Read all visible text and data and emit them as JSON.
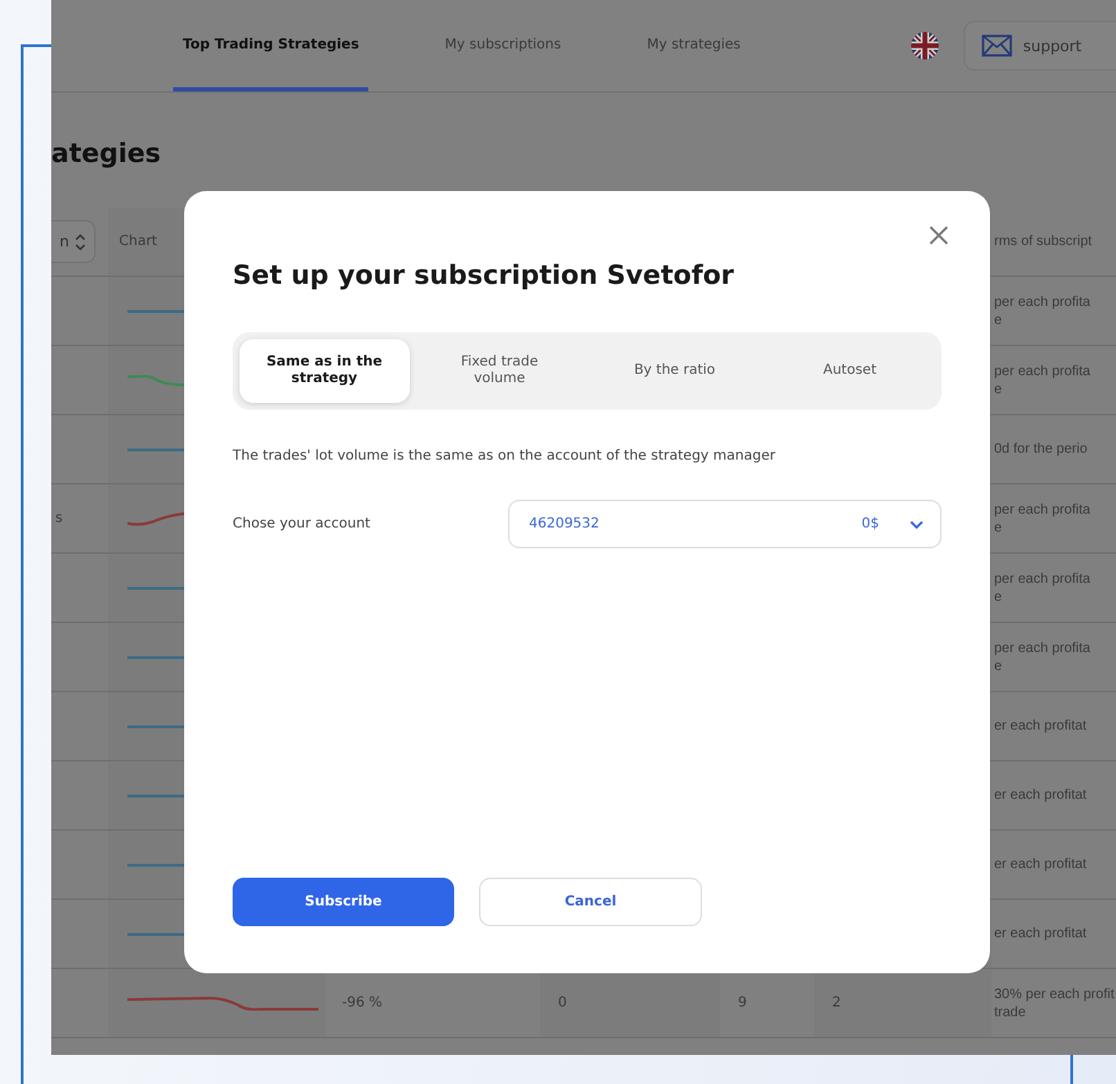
{
  "nav": {
    "tabs": [
      {
        "label": "Top Trading Strategies",
        "selected": true
      },
      {
        "label": "My subscriptions",
        "selected": false
      },
      {
        "label": "My strategies",
        "selected": false
      }
    ],
    "support": "support"
  },
  "page_title": "ategies",
  "table": {
    "sort_label": "n",
    "columns": [
      "Chart",
      "rms of subscript"
    ],
    "rows": [
      {
        "color": "#3e6a86",
        "kind": "flat",
        "terms": [
          "per each profita",
          "e"
        ]
      },
      {
        "color": "#3f8a55",
        "kind": "dip",
        "terms": [
          "per each profita",
          "e"
        ]
      },
      {
        "color": "#3e6a86",
        "kind": "flat",
        "terms": [
          "0d for the perio"
        ]
      },
      {
        "color": "#8a3a3a",
        "kind": "rise",
        "column_1": "s",
        "terms": [
          "per each profita",
          "e"
        ]
      },
      {
        "color": "#3e6a86",
        "kind": "flat",
        "terms": [
          "per each profita",
          "e"
        ]
      },
      {
        "color": "#3e6a86",
        "kind": "flat",
        "terms": [
          "per each profita",
          "e"
        ]
      },
      {
        "color": "#3e6a86",
        "kind": "flat",
        "terms": [
          "er each profitat"
        ]
      },
      {
        "color": "#3e6a86",
        "kind": "flat",
        "terms": [
          "er each profitat"
        ]
      },
      {
        "color": "#3e6a86",
        "kind": "flat",
        "terms": [
          "er each profitat"
        ]
      },
      {
        "color": "#3e6a86",
        "kind": "flat",
        "terms": [
          "er each profitat"
        ]
      },
      {
        "color": "#8a3a3a",
        "kind": "fall",
        "return": "-96 %",
        "column_4": "0",
        "column_5": "9",
        "column_6": "2",
        "terms": [
          "30% per each profit",
          "trade"
        ]
      }
    ]
  },
  "modal": {
    "title": "Set up your subscription Svetofor",
    "modes": [
      {
        "label": "Same as in the strategy",
        "selected": true
      },
      {
        "label": "Fixed trade volume",
        "selected": false
      },
      {
        "label": "By the ratio",
        "selected": false
      },
      {
        "label": "Autoset",
        "selected": false
      }
    ],
    "description": "The trades' lot volume is the same as on the account of the strategy manager",
    "account_label": "Chose your account",
    "account": {
      "value": "46209532",
      "balance": "0$"
    },
    "buttons": [
      "Subscribe",
      "Cancel"
    ]
  }
}
